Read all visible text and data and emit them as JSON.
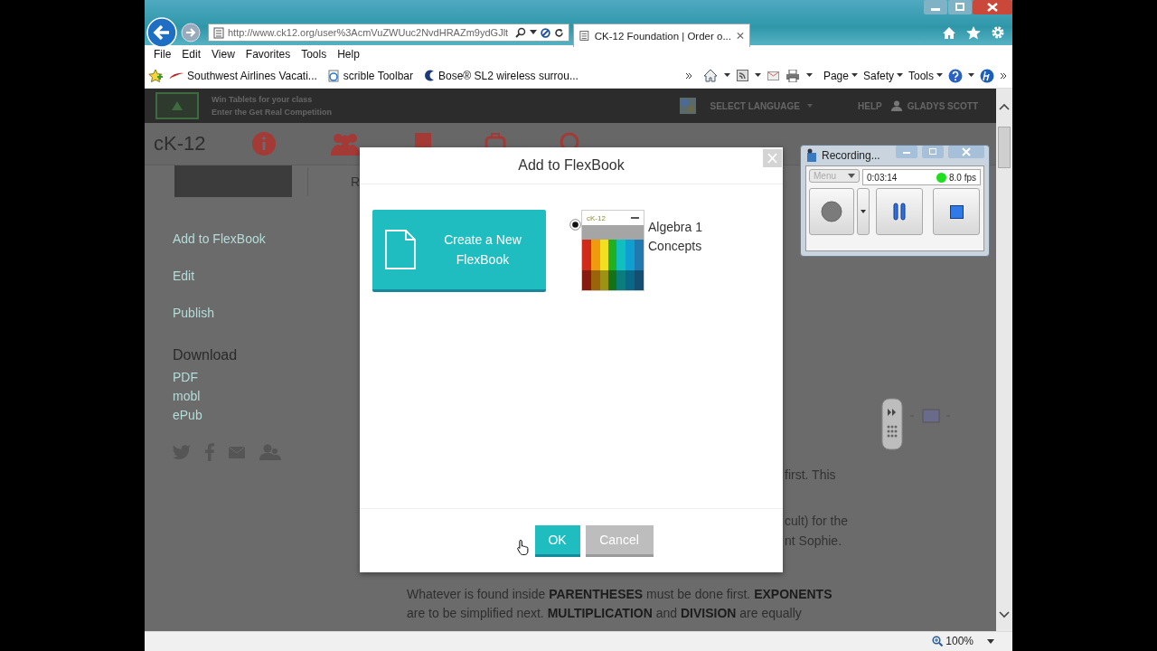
{
  "browser": {
    "address": "http://www.ck12.org/user%3AcmVuZWUuc2NvdHRAZm9ydGJlt",
    "tabs": [
      {
        "title": "CK-12 Foundation | Order o...",
        "selected": true
      }
    ],
    "menu": [
      "File",
      "Edit",
      "View",
      "Favorites",
      "Tools",
      "Help"
    ],
    "favorites": [
      "Southwest Airlines Vacati...",
      "scrible Toolbar",
      "Bose® SL2 wireless surrou..."
    ],
    "commands": [
      "Page",
      "Safety",
      "Tools"
    ],
    "zoom": "100%"
  },
  "site_header": {
    "promo": [
      "Win Tablets for your class",
      "Enter the Get Real Competition"
    ],
    "language": "SELECT LANGUAGE",
    "help": "HELP",
    "user": "GLADYS SCOTT"
  },
  "nav": {
    "logo": "cK-12"
  },
  "tab_fragment": "R",
  "sidebar": {
    "actions": [
      "Add to FlexBook",
      "Edit",
      "Publish"
    ],
    "download_heading": "Download",
    "downloads": [
      "PDF",
      "mobl",
      "ePub"
    ]
  },
  "content": {
    "line_ends": [
      "first. This",
      "cult) for the",
      "nt Sophie."
    ],
    "paragraph": "Whatever is found inside **PARENTHESES** must be done first. **EXPONENTS** are to be simplified next. **MULTIPLICATION** and **DIVISION** are equally"
  },
  "dialog": {
    "title": "Add to FlexBook",
    "create_button": "Create a New FlexBook",
    "books": [
      {
        "title": "Algebra 1 Concepts",
        "cover_logo": "cK-12",
        "selected": true
      }
    ],
    "ok": "OK",
    "cancel": "Cancel"
  },
  "recorder": {
    "title": "Recording...",
    "menu": "Menu",
    "time": "0:03:14",
    "fps": "8.0 fps"
  }
}
